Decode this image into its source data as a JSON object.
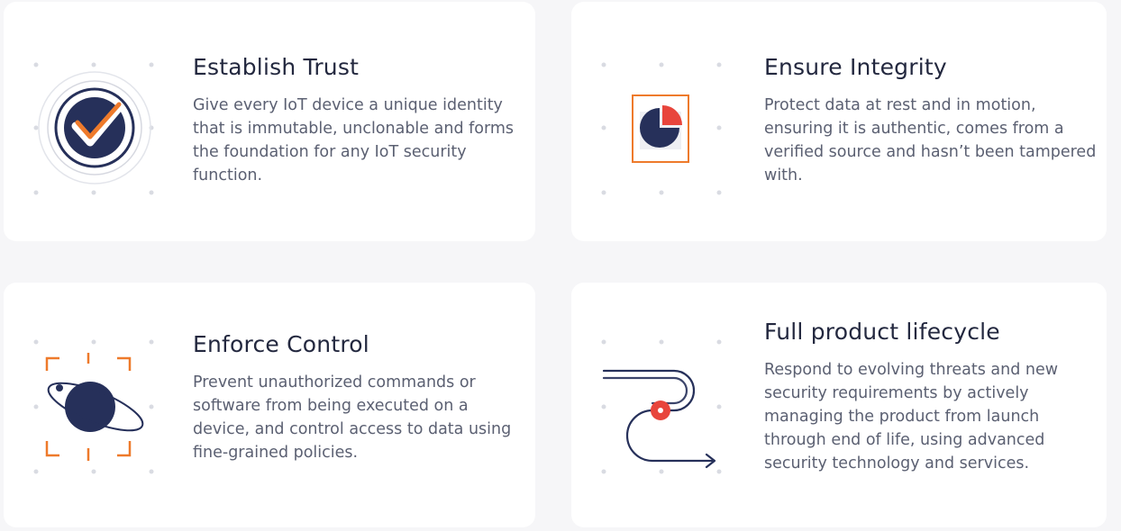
{
  "colors": {
    "navy": "#26305a",
    "orange": "#ee7a2b",
    "red": "#e8453c",
    "dot": "#d9dbe2",
    "ring": "#d6d8e0"
  },
  "cards": [
    {
      "id": "establish-trust",
      "icon": "verified-badge-icon",
      "title": "Establish Trust",
      "description": "Give every IoT device a unique identity that is immutable, unclonable and forms the foundation for any IoT security function."
    },
    {
      "id": "ensure-integrity",
      "icon": "pie-shield-icon",
      "title": "Ensure Integrity",
      "description": "Protect data at rest and in motion, ensuring it is authentic, comes from a verified source and hasn’t been tampered with."
    },
    {
      "id": "enforce-control",
      "icon": "orbit-target-icon",
      "title": "Enforce Control",
      "description": "Prevent unauthorized commands or software from being executed on a device, and control access to data using fine-grained policies."
    },
    {
      "id": "full-product-lifecycle",
      "icon": "lifecycle-path-icon",
      "title": "Full product lifecycle",
      "description": "Respond to evolving threats and new security requirements by actively managing the product from launch through end of life, using advanced security technology and services."
    }
  ]
}
